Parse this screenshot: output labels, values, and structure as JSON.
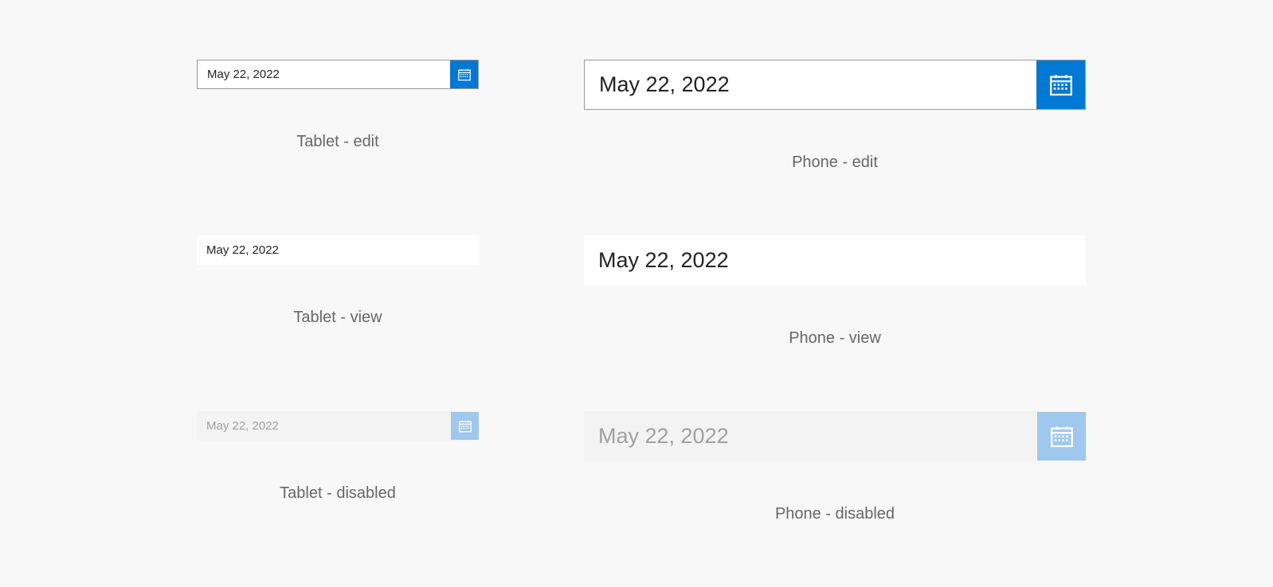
{
  "variants": {
    "tablet_edit": {
      "value": "May 22, 2022",
      "label": "Tablet - edit"
    },
    "phone_edit": {
      "value": "May 22, 2022",
      "label": "Phone - edit"
    },
    "tablet_view": {
      "value": "May 22, 2022",
      "label": "Tablet - view"
    },
    "phone_view": {
      "value": "May 22, 2022",
      "label": "Phone - view"
    },
    "tablet_disabled": {
      "value": "May 22, 2022",
      "label": "Tablet - disabled"
    },
    "phone_disabled": {
      "value": "May 22, 2022",
      "label": "Phone - disabled"
    }
  },
  "colors": {
    "accent": "#0078d4",
    "accent_disabled": "#9ec8ed",
    "text": "#222222",
    "text_disabled": "#a0a0a0",
    "caption": "#666666",
    "border": "#999999",
    "page_bg": "#f8f8f8",
    "field_bg": "#ffffff",
    "field_bg_disabled": "#f3f3f3"
  }
}
